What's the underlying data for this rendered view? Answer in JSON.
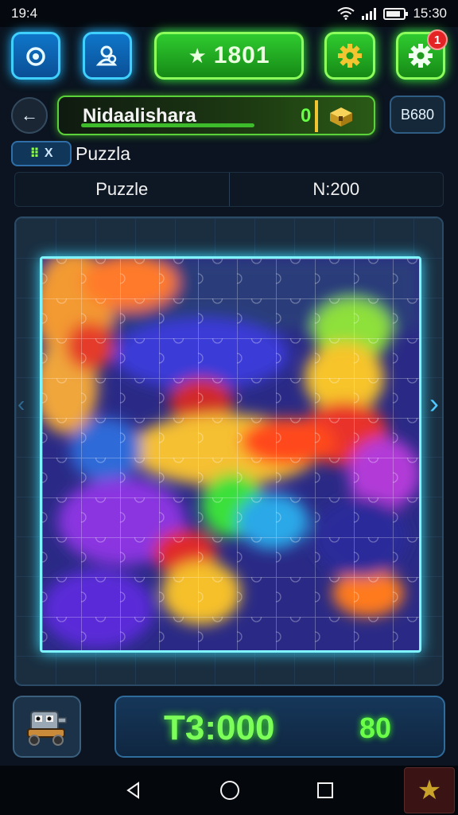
{
  "status": {
    "time_left": "19:4",
    "time_right": "15:30"
  },
  "topbar": {
    "score": "1801",
    "notification_count": "1"
  },
  "profile": {
    "name": "Nidaalishara",
    "value": "0",
    "code": "B680"
  },
  "puzzle_tag": {
    "icons_text_a": "⠿",
    "icons_text_b": "X",
    "label": "Puzzla"
  },
  "tabs": [
    {
      "label": "Puzzle"
    },
    {
      "label": "N:200"
    }
  ],
  "bottom": {
    "timer": "T3:000",
    "count": "80"
  },
  "colors": {
    "accent_blue": "#3fd0ff",
    "accent_green": "#5bd13a",
    "board_glow": "#7ff4ff"
  }
}
